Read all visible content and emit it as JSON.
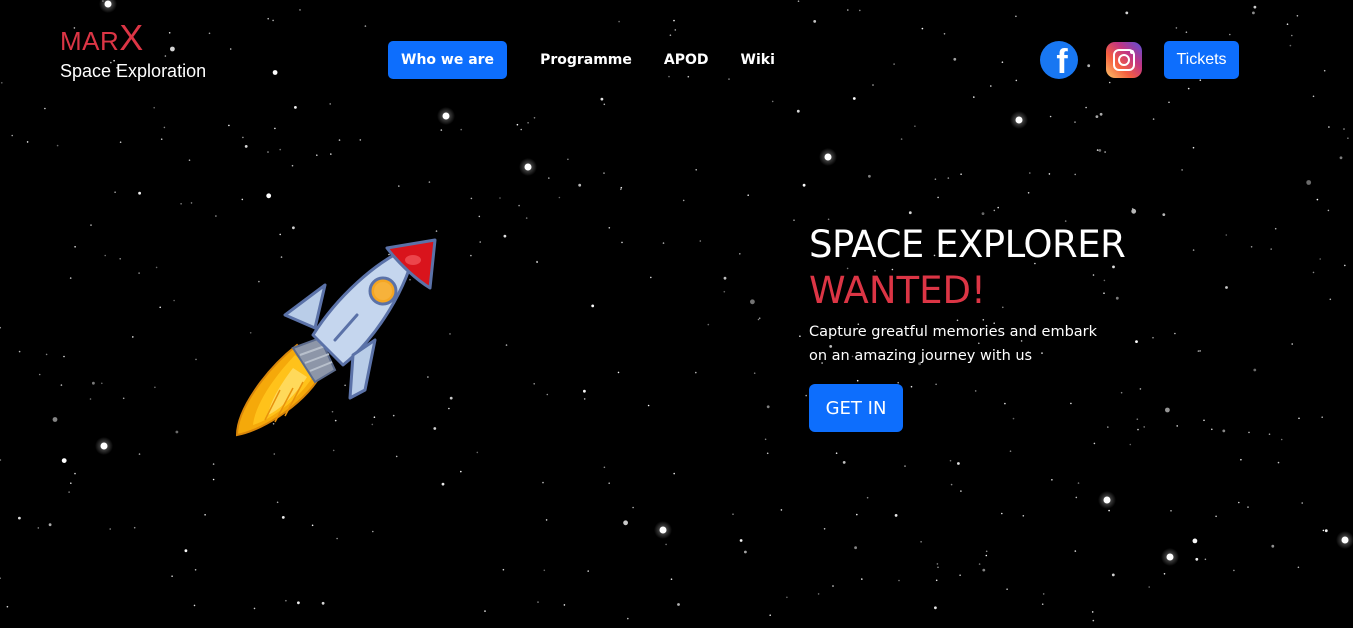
{
  "brand": {
    "logo_prefix": "MAR",
    "logo_suffix": "X",
    "subtitle": "Space Exploration"
  },
  "nav": {
    "primary_label": "Who we are",
    "links": [
      "Programme",
      "APOD",
      "Wiki"
    ]
  },
  "social": {
    "facebook_icon": "facebook-icon",
    "instagram_icon": "instagram-icon",
    "tickets_label": "Tickets"
  },
  "hero": {
    "title_line1": "SPACE EXPLORER",
    "title_line2": "WANTED!",
    "description": "Capture greatful memories and embark on an amazing journey with us",
    "cta_label": "GET IN"
  },
  "colors": {
    "accent_red": "#dc3545",
    "primary_blue": "#0d6efd",
    "background": "#000000"
  },
  "illustration": {
    "icon": "rocket-icon"
  }
}
